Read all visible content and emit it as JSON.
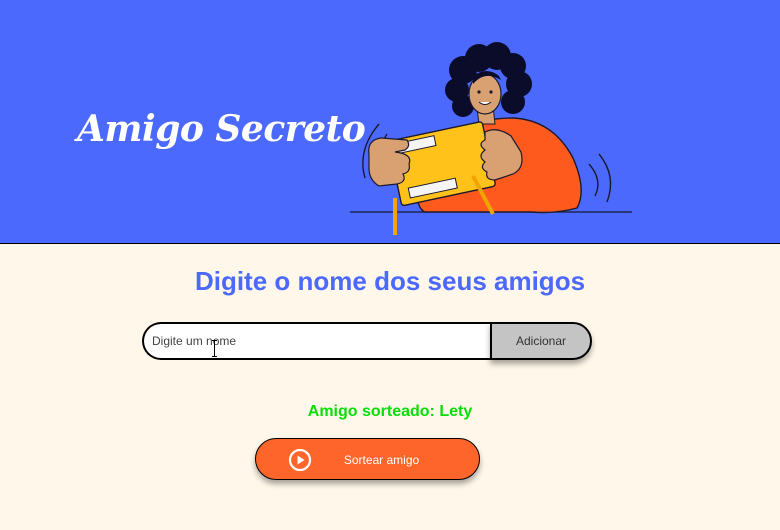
{
  "header": {
    "title": "Amigo Secreto",
    "background_color": "#4B69FD",
    "illustration": "person-holding-gift-box"
  },
  "main": {
    "heading": "Digite o nome dos seus amigos",
    "name_input": {
      "placeholder": "Digite um nome",
      "value": ""
    },
    "add_button_label": "Adicionar",
    "result_text": "Amigo sorteado: Lety",
    "draw_button_label": "Sortear amigo",
    "draw_button_icon": "play-circle-icon"
  },
  "colors": {
    "accent_blue": "#4B69FD",
    "page_background": "#FFF7EA",
    "draw_button": "#FE652B",
    "result_green": "#05DF05",
    "add_button": "#C4C4C4"
  }
}
